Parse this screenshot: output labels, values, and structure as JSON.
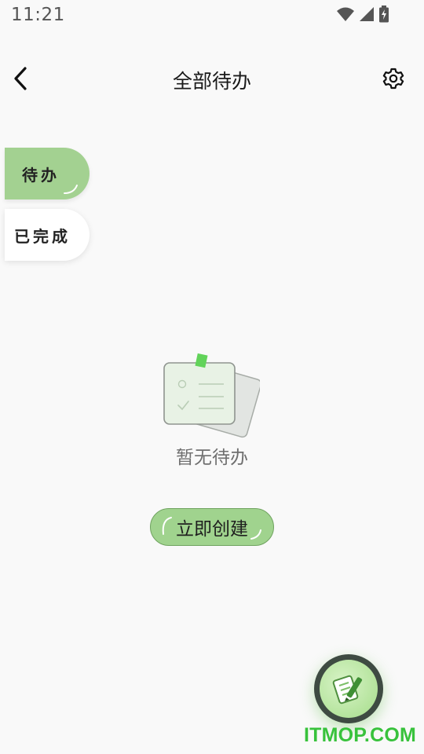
{
  "status_bar": {
    "time": "11:21",
    "icons": [
      "wifi-icon",
      "cellular-signal-icon",
      "battery-charging-icon"
    ]
  },
  "app_bar": {
    "title": "全部待办",
    "back_icon": "chevron-left-icon",
    "settings_icon": "gear-icon"
  },
  "side_tabs": [
    {
      "label": "待办",
      "selected": true,
      "color": "#a3d191"
    },
    {
      "label": "已完成",
      "selected": false,
      "color": "#ffffff"
    }
  ],
  "empty_state": {
    "illustration_icon": "checklist-note-icon",
    "message": "暂无待办"
  },
  "create_button": {
    "label": "立即创建",
    "color": "#a0d38e"
  },
  "fab": {
    "icon": "notebook-pencil-icon"
  },
  "watermark": "ITMOP.COM",
  "colors": {
    "accent": "#a3d191",
    "background": "#f9f9f9",
    "watermark": "#38c23c"
  }
}
